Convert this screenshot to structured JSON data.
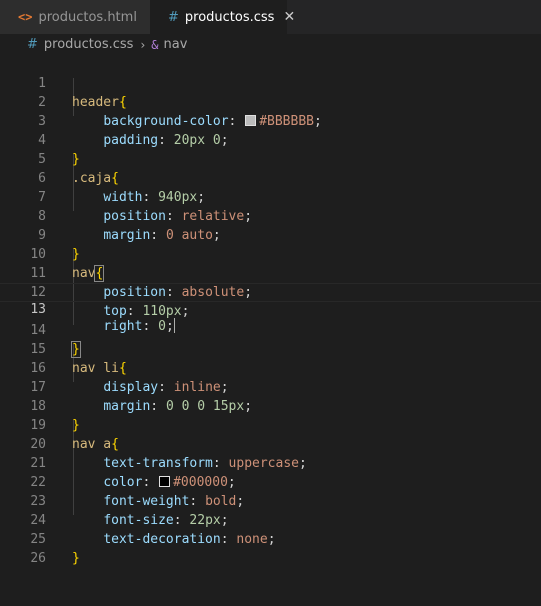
{
  "tabs": [
    {
      "label": "productos.html",
      "icon": "html-icon",
      "active": false
    },
    {
      "label": "productos.css",
      "icon": "css-icon",
      "active": true
    }
  ],
  "breadcrumb": {
    "file": "productos.css",
    "symbol": "nav"
  },
  "lines": [
    {
      "n": "1"
    },
    {
      "n": "2"
    },
    {
      "n": "3"
    },
    {
      "n": "4"
    },
    {
      "n": "5"
    },
    {
      "n": "6"
    },
    {
      "n": "7"
    },
    {
      "n": "8"
    },
    {
      "n": "9"
    },
    {
      "n": "10"
    },
    {
      "n": "11"
    },
    {
      "n": "12"
    },
    {
      "n": "13"
    },
    {
      "n": "14"
    },
    {
      "n": "15"
    },
    {
      "n": "16"
    },
    {
      "n": "17"
    },
    {
      "n": "18"
    },
    {
      "n": "19"
    },
    {
      "n": "20"
    },
    {
      "n": "21"
    },
    {
      "n": "22"
    },
    {
      "n": "23"
    },
    {
      "n": "24"
    },
    {
      "n": "25"
    },
    {
      "n": "26"
    }
  ],
  "code": {
    "l1_sel": "header",
    "l2_prop": "background-color",
    "l2_val": "#BBBBBB",
    "l3_prop": "padding",
    "l3_val": "20px 0",
    "l5_sel": ".caja",
    "l6_prop": "width",
    "l6_val": "940px",
    "l7_prop": "position",
    "l7_val": "relative",
    "l8_prop": "margin",
    "l8_val": "0 auto",
    "l10_sel": "nav",
    "l11_prop": "position",
    "l11_val": "absolute",
    "l12_prop": "top",
    "l12_val": "110px",
    "l13_prop": "right",
    "l13_val": "0",
    "l15_sel": "nav li",
    "l16_prop": "display",
    "l16_val": "inline",
    "l17_prop": "margin",
    "l17_val": "0 0 0 15px",
    "l19_sel": "nav a",
    "l20_prop": "text-transform",
    "l20_val": "uppercase",
    "l21_prop": "color",
    "l21_val": "#000000",
    "l22_prop": "font-weight",
    "l22_val": "bold",
    "l23_prop": "font-size",
    "l23_val": "22px",
    "l24_prop": "text-decoration",
    "l24_val": "none"
  },
  "colors": {
    "swatch_bbbbbb": "#BBBBBB",
    "swatch_000000": "#000000"
  }
}
